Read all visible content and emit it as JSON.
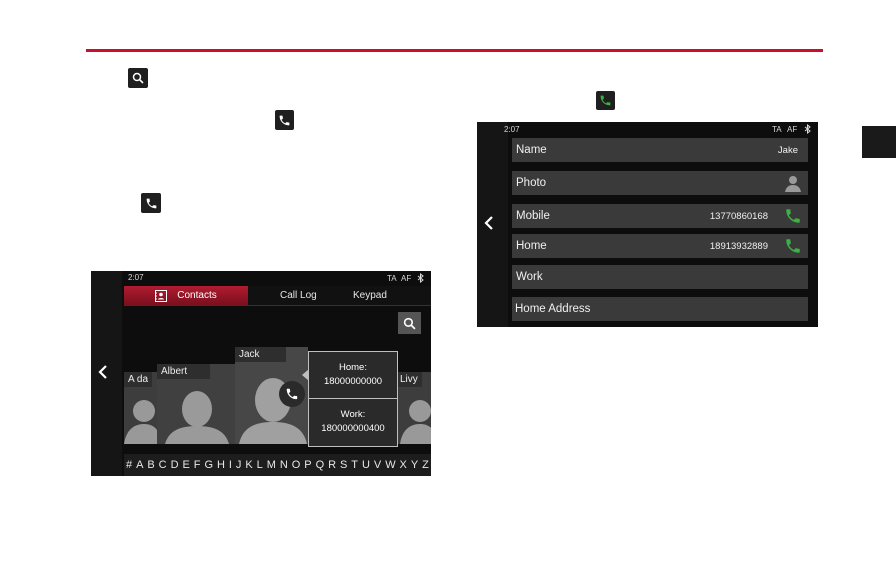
{
  "left_screen": {
    "time": "2:07",
    "status_ta": "TA",
    "status_af": "AF",
    "tabs": {
      "contacts": "Contacts",
      "call_log": "Call Log",
      "keypad": "Keypad"
    },
    "cards": [
      {
        "name": "A da"
      },
      {
        "name": "Albert"
      },
      {
        "name": "Jack"
      },
      {
        "name": "Livy"
      }
    ],
    "popup": {
      "home_label": "Home:",
      "home_number": "18000000000",
      "work_label": "Work:",
      "work_number": "180000000400"
    },
    "alphabet": [
      "#",
      "A",
      "B",
      "C",
      "D",
      "E",
      "F",
      "G",
      "H",
      "I",
      "J",
      "K",
      "L",
      "M",
      "N",
      "O",
      "P",
      "Q",
      "R",
      "S",
      "T",
      "U",
      "V",
      "W",
      "X",
      "Y",
      "Z"
    ]
  },
  "right_screen": {
    "time": "2:07",
    "status_ta": "TA",
    "status_af": "AF",
    "rows": {
      "name_label": "Name",
      "name_value": "Jake",
      "photo_label": "Photo",
      "mobile_label": "Mobile",
      "mobile_value": "13770860168",
      "home_label": "Home",
      "home_value": "18913932889",
      "work_label": "Work",
      "address_label": "Home Address"
    }
  },
  "colors": {
    "accent": "#c8102e",
    "call_green": "#3cb043"
  }
}
